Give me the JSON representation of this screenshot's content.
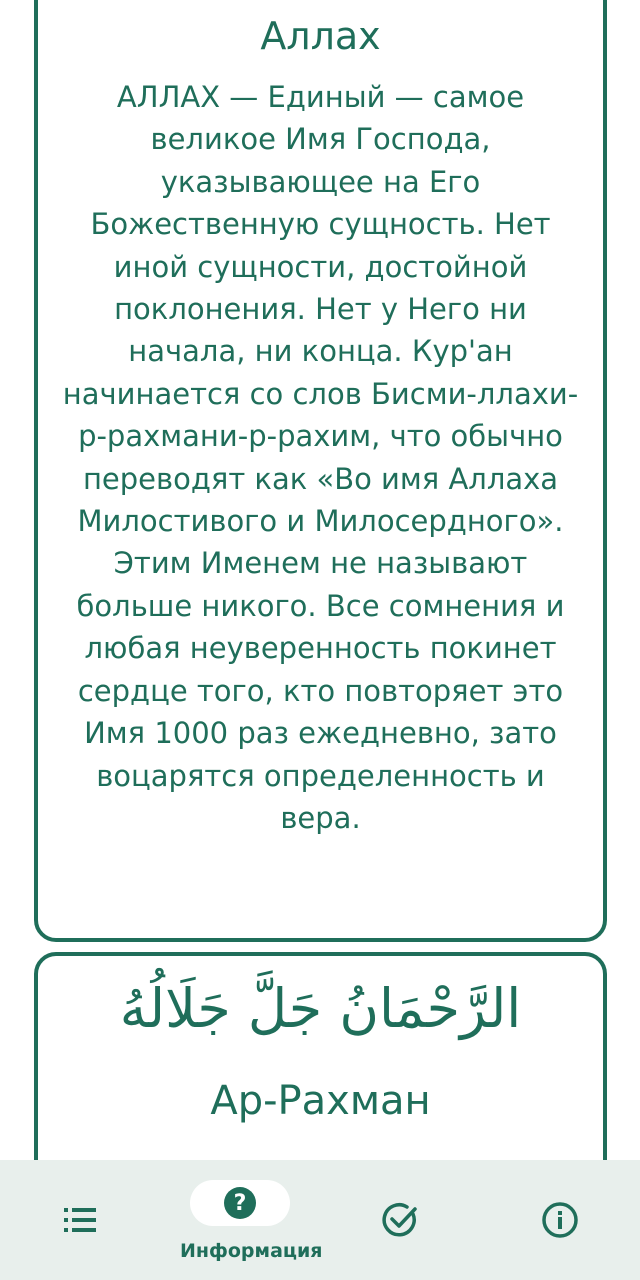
{
  "cards": [
    {
      "title": "Аллах",
      "description": "АЛЛАХ — Единый — самое великое Имя Господа, указывающее на Его Божественную сущность. Нет иной сущности, достойной поклонения. Нет у Него ни начала, ни конца. Кур'ан начинается со слов Бисми-ллахи-р-рахмани-р-рахим, что обычно переводят как «Во имя Аллаха Милостивого и Милосердного». Этим Именем не называют больше никого. Все сомнения и любая неуверенность покинет сердце того, кто повторяет это Имя 1000 раз ежедневно, зато воцарятся определенность и вера."
    },
    {
      "arabic": "الرَّحْمَانُ جَلَّ جَلَالُهُ",
      "title": "Ар-Рахман"
    }
  ],
  "bottom_nav": {
    "items": [
      {
        "icon": "list-icon",
        "label": ""
      },
      {
        "icon": "help-icon",
        "label": "Информация",
        "active": true
      },
      {
        "icon": "check-circle-icon",
        "label": ""
      },
      {
        "icon": "info-icon",
        "label": ""
      }
    ]
  },
  "colors": {
    "accent": "#1f6e5a",
    "nav_background": "#e8efec",
    "background": "#ffffff"
  }
}
